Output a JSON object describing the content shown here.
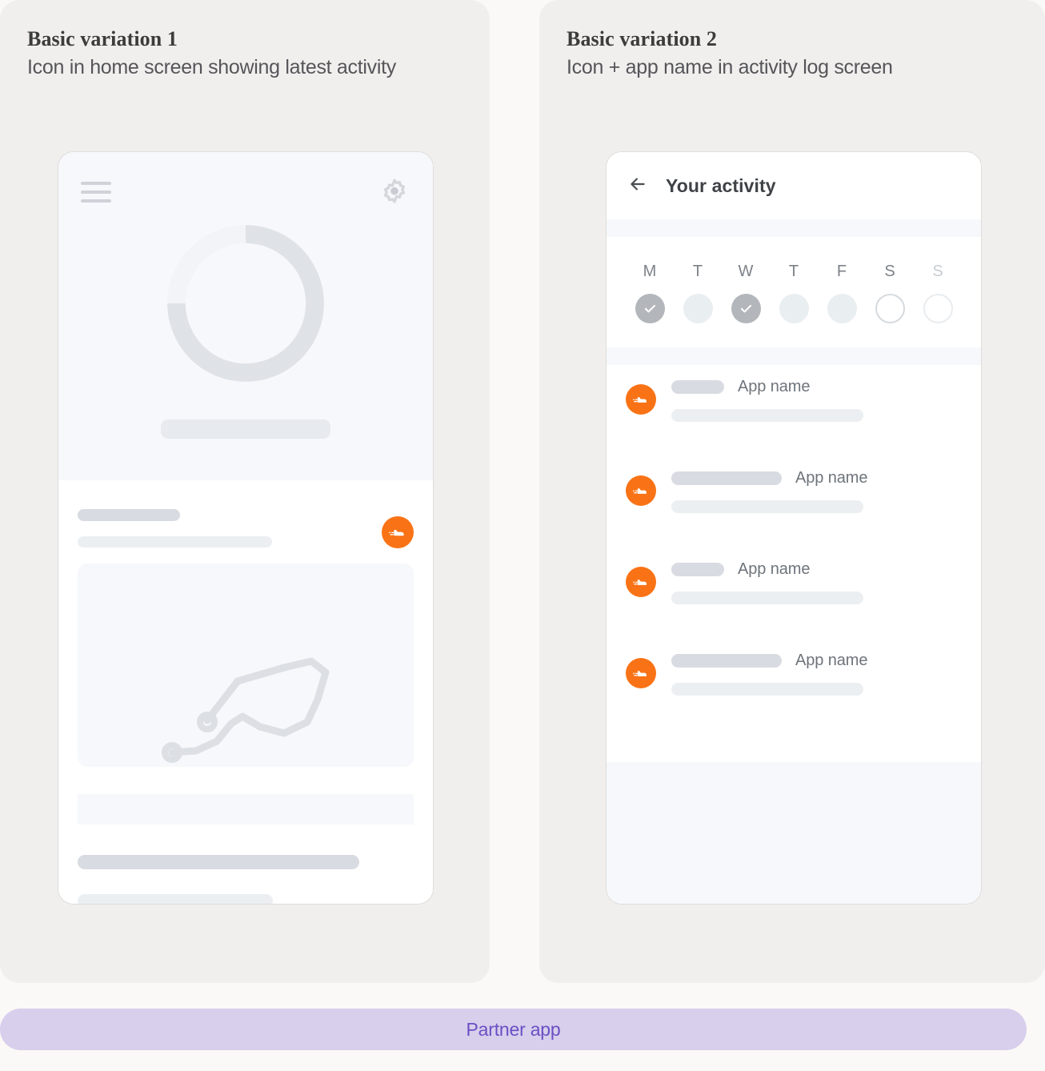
{
  "page": {
    "background_color": "#FAF9F7",
    "panel_color": "#F0EFED",
    "accent_color": "#F97316"
  },
  "panels": [
    {
      "title": "Basic variation 1",
      "subtitle": "Icon in home screen showing latest activity"
    },
    {
      "title": "Basic variation 2",
      "subtitle": "Icon + app name in activity log screen"
    }
  ],
  "phone_home": {
    "menu_icon": "hamburger-icon",
    "settings_icon": "gear-icon",
    "progress_ring": {
      "track_color": "#F1F3F6",
      "value_color": "#DFE2E7",
      "percent": 67
    },
    "activity_badge_icon": "running-shoe-icon",
    "route_map_icon": "route-path-icon"
  },
  "phone_activity": {
    "back_icon": "back-arrow-icon",
    "title": "Your activity",
    "week": [
      {
        "label": "M",
        "state": "done"
      },
      {
        "label": "T",
        "state": "empty"
      },
      {
        "label": "W",
        "state": "done"
      },
      {
        "label": "T",
        "state": "empty"
      },
      {
        "label": "F",
        "state": "empty"
      },
      {
        "label": "S",
        "state": "outline"
      },
      {
        "label": "S",
        "state": "outline-faint"
      }
    ],
    "check_icon": "check-icon",
    "log_rows": [
      {
        "icon": "running-shoe-icon",
        "pill": "short",
        "app_name": "App name"
      },
      {
        "icon": "running-shoe-icon",
        "pill": "long",
        "app_name": "App name"
      },
      {
        "icon": "running-shoe-icon",
        "pill": "short",
        "app_name": "App name"
      },
      {
        "icon": "running-shoe-icon",
        "pill": "long",
        "app_name": "App name"
      }
    ]
  },
  "footer": {
    "label": "Partner app",
    "background_color": "#D7CFEC",
    "text_color": "#6C4EC4"
  }
}
